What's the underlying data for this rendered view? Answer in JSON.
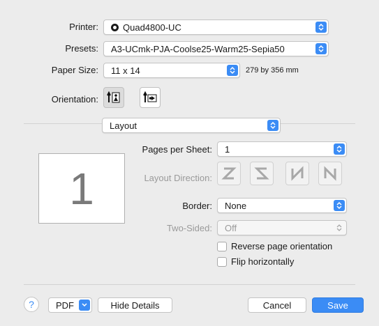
{
  "printer": {
    "label": "Printer:",
    "value": "Quad4800-UC",
    "icon": "printer-status-icon"
  },
  "presets": {
    "label": "Presets:",
    "value": "A3-UCmk-PJA-Coolse25-Warm25-Sepia50"
  },
  "paper_size": {
    "label": "Paper Size:",
    "value": "11 x 14",
    "dimensions": "279 by 356 mm"
  },
  "orientation": {
    "label": "Orientation:",
    "options": [
      "portrait",
      "landscape"
    ],
    "selected": "portrait"
  },
  "section": {
    "value": "Layout"
  },
  "preview": {
    "page_number": "1"
  },
  "layout": {
    "pages_per_sheet": {
      "label": "Pages per Sheet:",
      "value": "1"
    },
    "layout_direction": {
      "label": "Layout Direction:",
      "options": [
        "Z",
        "S",
        "N-reverse",
        "N"
      ]
    },
    "border": {
      "label": "Border:",
      "value": "None"
    },
    "two_sided": {
      "label": "Two-Sided:",
      "value": "Off"
    },
    "reverse_orientation": {
      "label": "Reverse page orientation",
      "checked": false
    },
    "flip_horizontally": {
      "label": "Flip horizontally",
      "checked": false
    }
  },
  "footer": {
    "help": "?",
    "pdf": "PDF",
    "hide_details": "Hide Details",
    "cancel": "Cancel",
    "save": "Save"
  },
  "colors": {
    "accent": "#3b8cf5",
    "background": "#ececec"
  }
}
